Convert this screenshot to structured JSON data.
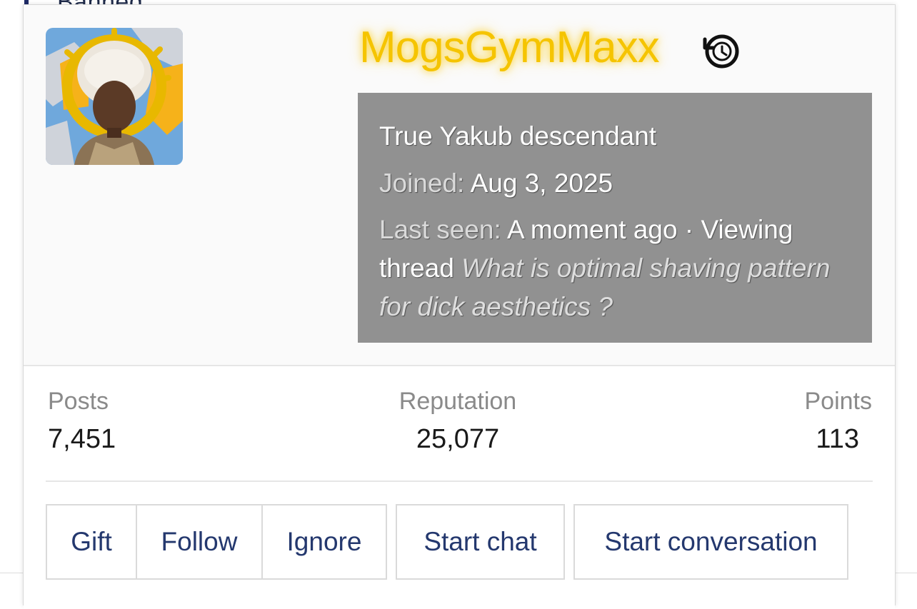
{
  "background": {
    "partial_text": "Banned"
  },
  "profile": {
    "username": "MogsGymMaxx",
    "title": "True Yakub descendant",
    "joined_label": "Joined:",
    "joined_value": "Aug 3, 2025",
    "last_seen_label": "Last seen:",
    "last_seen_value": "A moment ago · Viewing",
    "last_seen_thread_word": "thread",
    "thread_title": "What is optimal shaving pattern for dick aesthetics ?",
    "username_color": "#f5c400",
    "icons": [
      "history-icon"
    ]
  },
  "stats": {
    "posts_label": "Posts",
    "posts_value": "7,451",
    "reputation_label": "Reputation",
    "reputation_value": "25,077",
    "points_label": "Points",
    "points_value": "113"
  },
  "actions": {
    "gift": "Gift",
    "follow": "Follow",
    "ignore": "Ignore",
    "start_chat": "Start chat",
    "start_conversation": "Start conversation"
  },
  "colors": {
    "info_box_bg": "#919191",
    "button_text": "#24386e"
  }
}
